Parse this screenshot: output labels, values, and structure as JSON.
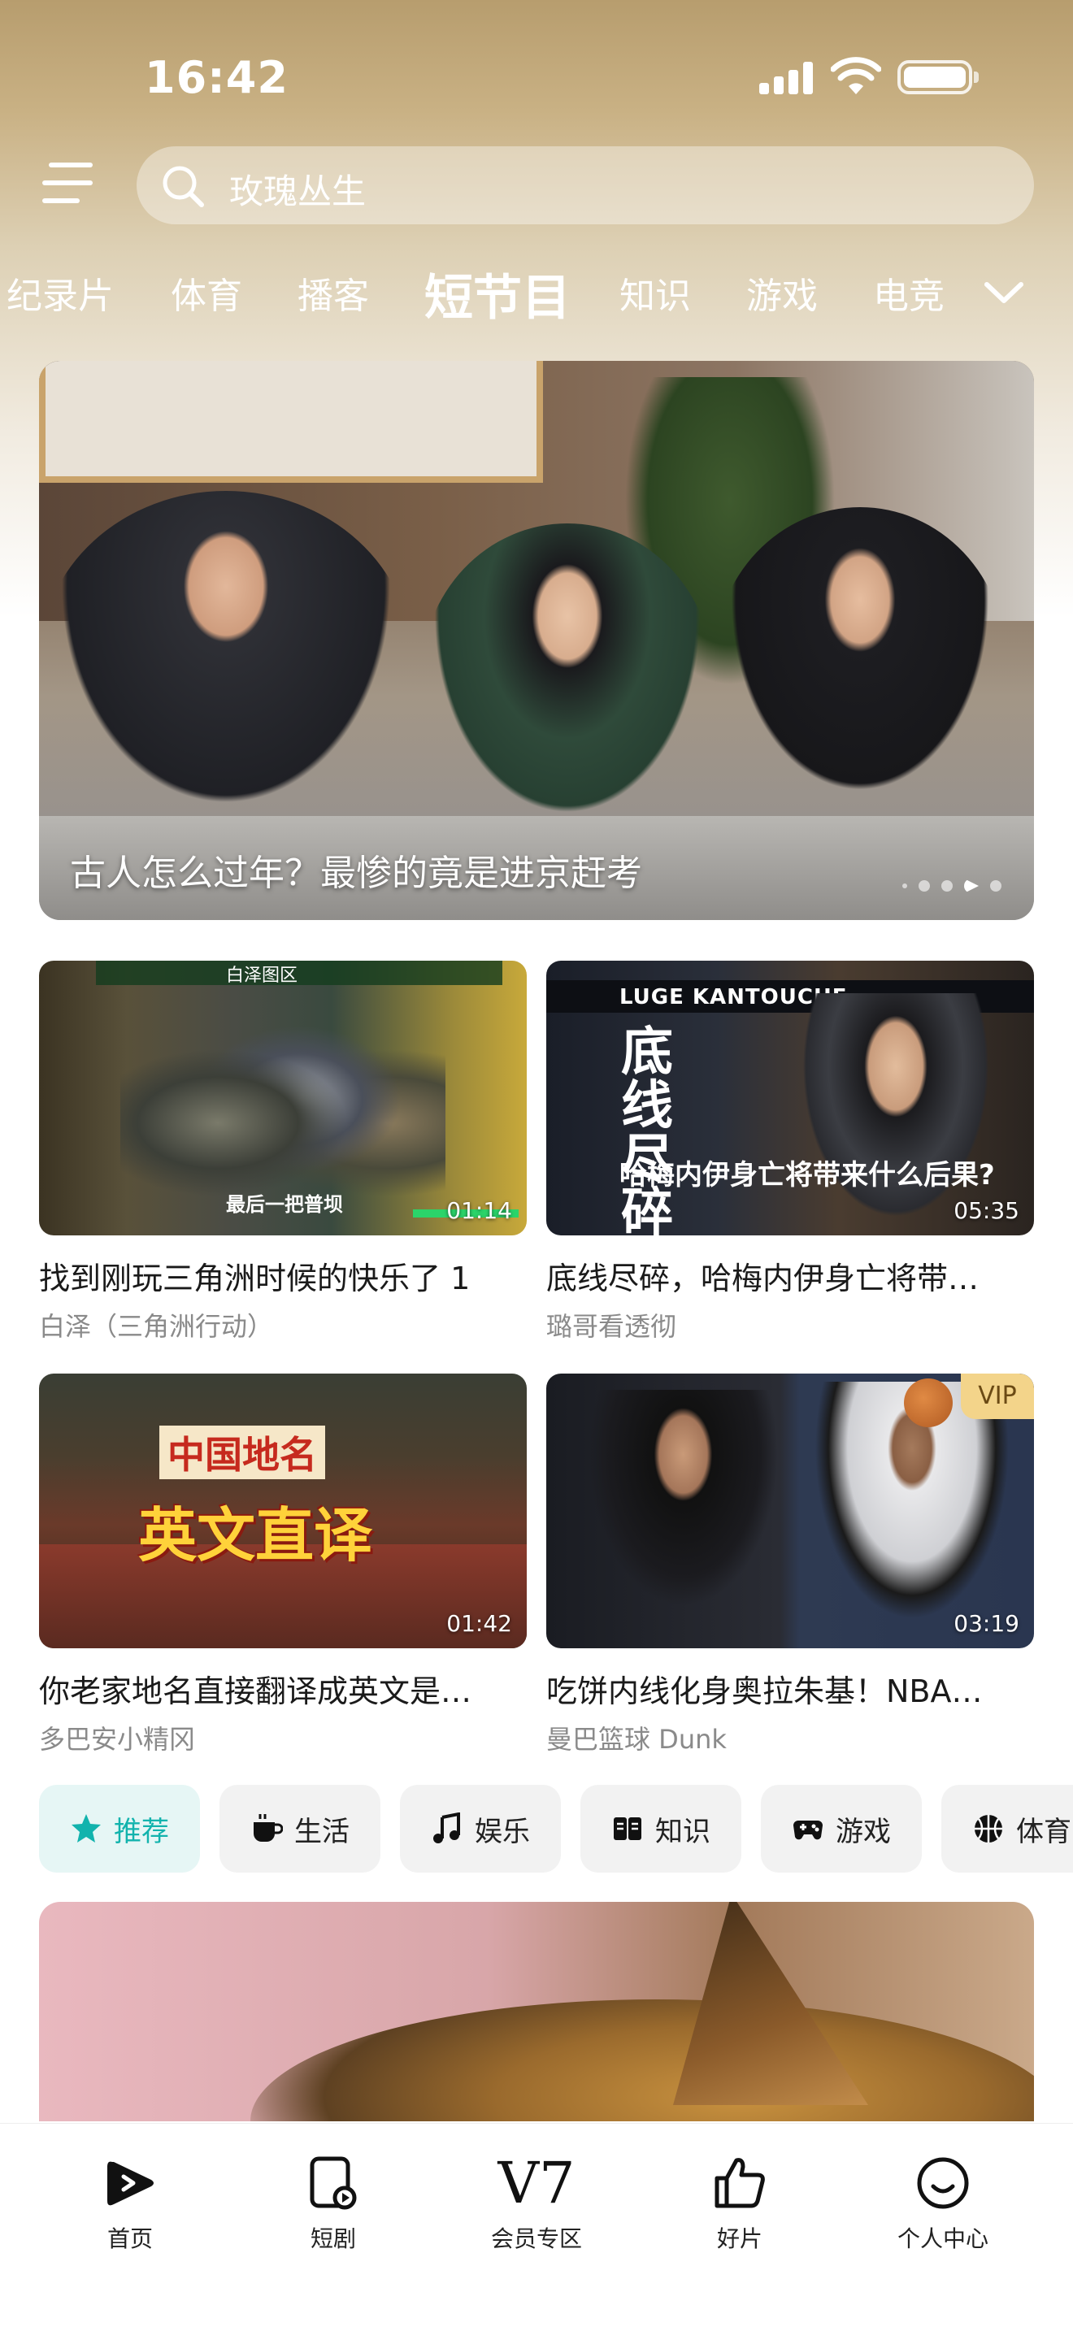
{
  "status_bar": {
    "time": "16:42"
  },
  "search": {
    "placeholder": "玫瑰丛生"
  },
  "categories": [
    {
      "label": "纪录片",
      "active": false
    },
    {
      "label": "体育",
      "active": false
    },
    {
      "label": "播客",
      "active": false
    },
    {
      "label": "短节目",
      "active": true
    },
    {
      "label": "知识",
      "active": false
    },
    {
      "label": "游戏",
      "active": false
    },
    {
      "label": "电竞",
      "active": false
    }
  ],
  "hero": {
    "title": "古人怎么过年？最惨的竟是进京赶考",
    "page_count": 5,
    "active_index": 3
  },
  "videos": [
    {
      "title": "找到刚玩三角洲时候的快乐了 1",
      "author": "白泽（三角洲行动）",
      "duration": "01:14",
      "vip": false,
      "overlay_text": "最后一把普坝",
      "top_text": "白泽图区"
    },
    {
      "title": "底线尽碎，哈梅内伊身亡将带…",
      "author": "璐哥看透彻",
      "duration": "05:35",
      "vip": false,
      "overlay_head": "LUGE KANTOUCHE",
      "overlay_big": "底线尽碎",
      "overlay_sub": "哈梅内伊身亡将带来什么后果?"
    },
    {
      "title": "你老家地名直接翻译成英文是…",
      "author": "多巴安小精冈",
      "duration": "01:42",
      "vip": false,
      "overlay_top": "中国地名",
      "overlay_big": "英文直译"
    },
    {
      "title": "吃饼内线化身奥拉朱基！NBA…",
      "author": "曼巴篮球 Dunk",
      "duration": "03:19",
      "vip": true,
      "vip_label": "VIP"
    }
  ],
  "chips": [
    {
      "label": "推荐",
      "icon": "star-icon",
      "active": true
    },
    {
      "label": "生活",
      "icon": "coffee-icon",
      "active": false
    },
    {
      "label": "娱乐",
      "icon": "music-icon",
      "active": false
    },
    {
      "label": "知识",
      "icon": "book-icon",
      "active": false
    },
    {
      "label": "游戏",
      "icon": "gamepad-icon",
      "active": false
    },
    {
      "label": "体育",
      "icon": "basketball-icon",
      "active": false
    }
  ],
  "tab_bar": [
    {
      "label": "首页",
      "icon": "play-icon"
    },
    {
      "label": "短剧",
      "icon": "short-drama-icon"
    },
    {
      "label": "会员专区",
      "icon": "v7-logo",
      "logo_text": "V7"
    },
    {
      "label": "好片",
      "icon": "thumbs-up-icon"
    },
    {
      "label": "个人中心",
      "icon": "smile-icon"
    }
  ],
  "colors": {
    "accent": "#12b3ad",
    "vip": "#f3d48a",
    "header_gradient_top": "#b79d6e"
  }
}
